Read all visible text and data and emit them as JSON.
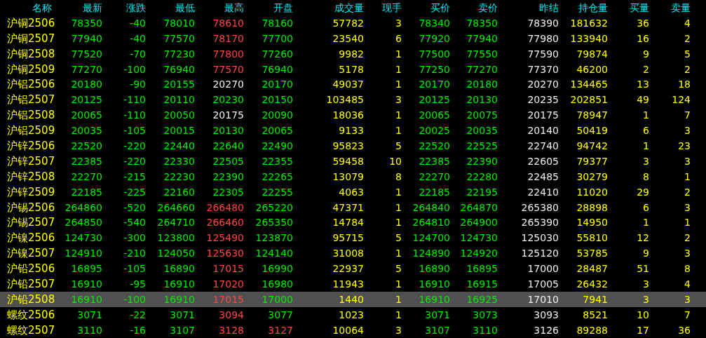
{
  "table": {
    "columns": [
      "名称",
      "最新",
      "涨跌",
      "最低",
      "最高",
      "开盘",
      "成交量",
      "现手",
      "买价",
      "卖价",
      "昨结",
      "持仓量",
      "买量",
      "卖量"
    ],
    "rows": [
      {
        "selected": false,
        "cells": [
          {
            "text": "沪铜2506",
            "color": "#ffff00"
          },
          {
            "text": "78350",
            "color": "#00ee00"
          },
          {
            "text": "-40",
            "color": "#00ee00"
          },
          {
            "text": "78010",
            "color": "#00ee00"
          },
          {
            "text": "78610",
            "color": "#ff4444"
          },
          {
            "text": "78160",
            "color": "#00ee00"
          },
          {
            "text": "57782",
            "color": "#ffff00"
          },
          {
            "text": "3",
            "color": "#ffff00"
          },
          {
            "text": "78340",
            "color": "#00ee00"
          },
          {
            "text": "78350",
            "color": "#00ee00"
          },
          {
            "text": "78390",
            "color": "#eeeeee"
          },
          {
            "text": "181632",
            "color": "#ffff00"
          },
          {
            "text": "36",
            "color": "#ffff00"
          },
          {
            "text": "4",
            "color": "#ffff00"
          }
        ]
      },
      {
        "selected": false,
        "cells": [
          {
            "text": "沪铜2507",
            "color": "#ffff00"
          },
          {
            "text": "77940",
            "color": "#00ee00"
          },
          {
            "text": "-40",
            "color": "#00ee00"
          },
          {
            "text": "77570",
            "color": "#00ee00"
          },
          {
            "text": "78170",
            "color": "#ff4444"
          },
          {
            "text": "77700",
            "color": "#00ee00"
          },
          {
            "text": "23540",
            "color": "#ffff00"
          },
          {
            "text": "6",
            "color": "#ffff00"
          },
          {
            "text": "77920",
            "color": "#00ee00"
          },
          {
            "text": "77940",
            "color": "#00ee00"
          },
          {
            "text": "77980",
            "color": "#eeeeee"
          },
          {
            "text": "133940",
            "color": "#ffff00"
          },
          {
            "text": "16",
            "color": "#ffff00"
          },
          {
            "text": "2",
            "color": "#ffff00"
          }
        ]
      },
      {
        "selected": false,
        "cells": [
          {
            "text": "沪铜2508",
            "color": "#ffff00"
          },
          {
            "text": "77520",
            "color": "#00ee00"
          },
          {
            "text": "-70",
            "color": "#00ee00"
          },
          {
            "text": "77230",
            "color": "#00ee00"
          },
          {
            "text": "77800",
            "color": "#ff4444"
          },
          {
            "text": "77260",
            "color": "#00ee00"
          },
          {
            "text": "9982",
            "color": "#ffff00"
          },
          {
            "text": "1",
            "color": "#ffff00"
          },
          {
            "text": "77500",
            "color": "#00ee00"
          },
          {
            "text": "77550",
            "color": "#00ee00"
          },
          {
            "text": "77590",
            "color": "#eeeeee"
          },
          {
            "text": "79874",
            "color": "#ffff00"
          },
          {
            "text": "9",
            "color": "#ffff00"
          },
          {
            "text": "5",
            "color": "#ffff00"
          }
        ]
      },
      {
        "selected": false,
        "cells": [
          {
            "text": "沪铜2509",
            "color": "#ffff00"
          },
          {
            "text": "77270",
            "color": "#00ee00"
          },
          {
            "text": "-100",
            "color": "#00ee00"
          },
          {
            "text": "76940",
            "color": "#00ee00"
          },
          {
            "text": "77570",
            "color": "#ff4444"
          },
          {
            "text": "76940",
            "color": "#00ee00"
          },
          {
            "text": "5178",
            "color": "#ffff00"
          },
          {
            "text": "1",
            "color": "#ffff00"
          },
          {
            "text": "77250",
            "color": "#00ee00"
          },
          {
            "text": "77270",
            "color": "#00ee00"
          },
          {
            "text": "77370",
            "color": "#eeeeee"
          },
          {
            "text": "46200",
            "color": "#ffff00"
          },
          {
            "text": "2",
            "color": "#ffff00"
          },
          {
            "text": "2",
            "color": "#ffff00"
          }
        ]
      },
      {
        "selected": false,
        "cells": [
          {
            "text": "沪铝2506",
            "color": "#ffff00"
          },
          {
            "text": "20180",
            "color": "#00ee00"
          },
          {
            "text": "-90",
            "color": "#00ee00"
          },
          {
            "text": "20155",
            "color": "#00ee00"
          },
          {
            "text": "20270",
            "color": "#eeeeee"
          },
          {
            "text": "20170",
            "color": "#00ee00"
          },
          {
            "text": "49037",
            "color": "#ffff00"
          },
          {
            "text": "1",
            "color": "#ffff00"
          },
          {
            "text": "20170",
            "color": "#00ee00"
          },
          {
            "text": "20180",
            "color": "#00ee00"
          },
          {
            "text": "20270",
            "color": "#eeeeee"
          },
          {
            "text": "134465",
            "color": "#ffff00"
          },
          {
            "text": "13",
            "color": "#ffff00"
          },
          {
            "text": "18",
            "color": "#ffff00"
          }
        ]
      },
      {
        "selected": false,
        "cells": [
          {
            "text": "沪铝2507",
            "color": "#ffff00"
          },
          {
            "text": "20125",
            "color": "#00ee00"
          },
          {
            "text": "-110",
            "color": "#00ee00"
          },
          {
            "text": "20110",
            "color": "#00ee00"
          },
          {
            "text": "20230",
            "color": "#00ee00"
          },
          {
            "text": "20150",
            "color": "#00ee00"
          },
          {
            "text": "103485",
            "color": "#ffff00"
          },
          {
            "text": "3",
            "color": "#ffff00"
          },
          {
            "text": "20125",
            "color": "#00ee00"
          },
          {
            "text": "20130",
            "color": "#00ee00"
          },
          {
            "text": "20235",
            "color": "#eeeeee"
          },
          {
            "text": "202851",
            "color": "#ffff00"
          },
          {
            "text": "49",
            "color": "#ffff00"
          },
          {
            "text": "124",
            "color": "#ffff00"
          }
        ]
      },
      {
        "selected": false,
        "cells": [
          {
            "text": "沪铝2508",
            "color": "#ffff00"
          },
          {
            "text": "20065",
            "color": "#00ee00"
          },
          {
            "text": "-110",
            "color": "#00ee00"
          },
          {
            "text": "20050",
            "color": "#00ee00"
          },
          {
            "text": "20175",
            "color": "#eeeeee"
          },
          {
            "text": "20090",
            "color": "#00ee00"
          },
          {
            "text": "18036",
            "color": "#ffff00"
          },
          {
            "text": "1",
            "color": "#ffff00"
          },
          {
            "text": "20065",
            "color": "#00ee00"
          },
          {
            "text": "20075",
            "color": "#00ee00"
          },
          {
            "text": "20175",
            "color": "#eeeeee"
          },
          {
            "text": "78947",
            "color": "#ffff00"
          },
          {
            "text": "1",
            "color": "#ffff00"
          },
          {
            "text": "7",
            "color": "#ffff00"
          }
        ]
      },
      {
        "selected": false,
        "cells": [
          {
            "text": "沪铝2509",
            "color": "#ffff00"
          },
          {
            "text": "20035",
            "color": "#00ee00"
          },
          {
            "text": "-105",
            "color": "#00ee00"
          },
          {
            "text": "20015",
            "color": "#00ee00"
          },
          {
            "text": "20130",
            "color": "#00ee00"
          },
          {
            "text": "20065",
            "color": "#00ee00"
          },
          {
            "text": "9133",
            "color": "#ffff00"
          },
          {
            "text": "1",
            "color": "#ffff00"
          },
          {
            "text": "20025",
            "color": "#00ee00"
          },
          {
            "text": "20035",
            "color": "#00ee00"
          },
          {
            "text": "20140",
            "color": "#eeeeee"
          },
          {
            "text": "50419",
            "color": "#ffff00"
          },
          {
            "text": "6",
            "color": "#ffff00"
          },
          {
            "text": "3",
            "color": "#ffff00"
          }
        ]
      },
      {
        "selected": false,
        "cells": [
          {
            "text": "沪锌2506",
            "color": "#ffff00"
          },
          {
            "text": "22520",
            "color": "#00ee00"
          },
          {
            "text": "-220",
            "color": "#00ee00"
          },
          {
            "text": "22440",
            "color": "#00ee00"
          },
          {
            "text": "22640",
            "color": "#00ee00"
          },
          {
            "text": "22490",
            "color": "#00ee00"
          },
          {
            "text": "95823",
            "color": "#ffff00"
          },
          {
            "text": "5",
            "color": "#ffff00"
          },
          {
            "text": "22520",
            "color": "#00ee00"
          },
          {
            "text": "22525",
            "color": "#00ee00"
          },
          {
            "text": "22740",
            "color": "#eeeeee"
          },
          {
            "text": "94742",
            "color": "#ffff00"
          },
          {
            "text": "1",
            "color": "#ffff00"
          },
          {
            "text": "23",
            "color": "#ffff00"
          }
        ]
      },
      {
        "selected": false,
        "cells": [
          {
            "text": "沪锌2507",
            "color": "#ffff00"
          },
          {
            "text": "22385",
            "color": "#00ee00"
          },
          {
            "text": "-220",
            "color": "#00ee00"
          },
          {
            "text": "22330",
            "color": "#00ee00"
          },
          {
            "text": "22505",
            "color": "#00ee00"
          },
          {
            "text": "22355",
            "color": "#00ee00"
          },
          {
            "text": "59458",
            "color": "#ffff00"
          },
          {
            "text": "10",
            "color": "#ffff00"
          },
          {
            "text": "22385",
            "color": "#00ee00"
          },
          {
            "text": "22390",
            "color": "#00ee00"
          },
          {
            "text": "22605",
            "color": "#eeeeee"
          },
          {
            "text": "79377",
            "color": "#ffff00"
          },
          {
            "text": "3",
            "color": "#ffff00"
          },
          {
            "text": "3",
            "color": "#ffff00"
          }
        ]
      },
      {
        "selected": false,
        "cells": [
          {
            "text": "沪锌2508",
            "color": "#ffff00"
          },
          {
            "text": "22270",
            "color": "#00ee00"
          },
          {
            "text": "-215",
            "color": "#00ee00"
          },
          {
            "text": "22230",
            "color": "#00ee00"
          },
          {
            "text": "22390",
            "color": "#00ee00"
          },
          {
            "text": "22265",
            "color": "#00ee00"
          },
          {
            "text": "13079",
            "color": "#ffff00"
          },
          {
            "text": "8",
            "color": "#ffff00"
          },
          {
            "text": "22270",
            "color": "#00ee00"
          },
          {
            "text": "22280",
            "color": "#00ee00"
          },
          {
            "text": "22485",
            "color": "#eeeeee"
          },
          {
            "text": "30279",
            "color": "#ffff00"
          },
          {
            "text": "8",
            "color": "#ffff00"
          },
          {
            "text": "1",
            "color": "#ffff00"
          }
        ]
      },
      {
        "selected": false,
        "cells": [
          {
            "text": "沪锌2509",
            "color": "#ffff00"
          },
          {
            "text": "22185",
            "color": "#00ee00"
          },
          {
            "text": "-225",
            "color": "#00ee00"
          },
          {
            "text": "22160",
            "color": "#00ee00"
          },
          {
            "text": "22305",
            "color": "#00ee00"
          },
          {
            "text": "22255",
            "color": "#00ee00"
          },
          {
            "text": "4063",
            "color": "#ffff00"
          },
          {
            "text": "1",
            "color": "#ffff00"
          },
          {
            "text": "22185",
            "color": "#00ee00"
          },
          {
            "text": "22195",
            "color": "#00ee00"
          },
          {
            "text": "22410",
            "color": "#eeeeee"
          },
          {
            "text": "11020",
            "color": "#ffff00"
          },
          {
            "text": "29",
            "color": "#ffff00"
          },
          {
            "text": "2",
            "color": "#ffff00"
          }
        ]
      },
      {
        "selected": false,
        "cells": [
          {
            "text": "沪锡2506",
            "color": "#ffff00"
          },
          {
            "text": "264860",
            "color": "#00ee00"
          },
          {
            "text": "-520",
            "color": "#00ee00"
          },
          {
            "text": "264660",
            "color": "#00ee00"
          },
          {
            "text": "266480",
            "color": "#ff4444"
          },
          {
            "text": "265220",
            "color": "#00ee00"
          },
          {
            "text": "47371",
            "color": "#ffff00"
          },
          {
            "text": "1",
            "color": "#ffff00"
          },
          {
            "text": "264840",
            "color": "#00ee00"
          },
          {
            "text": "264870",
            "color": "#00ee00"
          },
          {
            "text": "265380",
            "color": "#eeeeee"
          },
          {
            "text": "28898",
            "color": "#ffff00"
          },
          {
            "text": "6",
            "color": "#ffff00"
          },
          {
            "text": "3",
            "color": "#ffff00"
          }
        ]
      },
      {
        "selected": false,
        "cells": [
          {
            "text": "沪锡2507",
            "color": "#ffff00"
          },
          {
            "text": "264850",
            "color": "#00ee00"
          },
          {
            "text": "-540",
            "color": "#00ee00"
          },
          {
            "text": "264710",
            "color": "#00ee00"
          },
          {
            "text": "266460",
            "color": "#ff4444"
          },
          {
            "text": "265350",
            "color": "#00ee00"
          },
          {
            "text": "14784",
            "color": "#ffff00"
          },
          {
            "text": "1",
            "color": "#ffff00"
          },
          {
            "text": "264810",
            "color": "#00ee00"
          },
          {
            "text": "264900",
            "color": "#00ee00"
          },
          {
            "text": "265390",
            "color": "#eeeeee"
          },
          {
            "text": "14950",
            "color": "#ffff00"
          },
          {
            "text": "1",
            "color": "#ffff00"
          },
          {
            "text": "1",
            "color": "#ffff00"
          }
        ]
      },
      {
        "selected": false,
        "cells": [
          {
            "text": "沪镍2506",
            "color": "#ffff00"
          },
          {
            "text": "124730",
            "color": "#00ee00"
          },
          {
            "text": "-300",
            "color": "#00ee00"
          },
          {
            "text": "123800",
            "color": "#00ee00"
          },
          {
            "text": "125490",
            "color": "#ff4444"
          },
          {
            "text": "123870",
            "color": "#00ee00"
          },
          {
            "text": "95715",
            "color": "#ffff00"
          },
          {
            "text": "5",
            "color": "#ffff00"
          },
          {
            "text": "124700",
            "color": "#00ee00"
          },
          {
            "text": "124730",
            "color": "#00ee00"
          },
          {
            "text": "125030",
            "color": "#eeeeee"
          },
          {
            "text": "55810",
            "color": "#ffff00"
          },
          {
            "text": "12",
            "color": "#ffff00"
          },
          {
            "text": "2",
            "color": "#ffff00"
          }
        ]
      },
      {
        "selected": false,
        "cells": [
          {
            "text": "沪镍2507",
            "color": "#ffff00"
          },
          {
            "text": "124910",
            "color": "#00ee00"
          },
          {
            "text": "-210",
            "color": "#00ee00"
          },
          {
            "text": "124050",
            "color": "#00ee00"
          },
          {
            "text": "125630",
            "color": "#ff4444"
          },
          {
            "text": "124140",
            "color": "#00ee00"
          },
          {
            "text": "31008",
            "color": "#ffff00"
          },
          {
            "text": "1",
            "color": "#ffff00"
          },
          {
            "text": "124890",
            "color": "#00ee00"
          },
          {
            "text": "124920",
            "color": "#00ee00"
          },
          {
            "text": "125120",
            "color": "#eeeeee"
          },
          {
            "text": "53785",
            "color": "#ffff00"
          },
          {
            "text": "9",
            "color": "#ffff00"
          },
          {
            "text": "3",
            "color": "#ffff00"
          }
        ]
      },
      {
        "selected": false,
        "cells": [
          {
            "text": "沪铅2506",
            "color": "#ffff00"
          },
          {
            "text": "16895",
            "color": "#00ee00"
          },
          {
            "text": "-105",
            "color": "#00ee00"
          },
          {
            "text": "16890",
            "color": "#00ee00"
          },
          {
            "text": "17015",
            "color": "#ff4444"
          },
          {
            "text": "16990",
            "color": "#00ee00"
          },
          {
            "text": "22937",
            "color": "#ffff00"
          },
          {
            "text": "5",
            "color": "#ffff00"
          },
          {
            "text": "16890",
            "color": "#00ee00"
          },
          {
            "text": "16895",
            "color": "#00ee00"
          },
          {
            "text": "17000",
            "color": "#eeeeee"
          },
          {
            "text": "28487",
            "color": "#ffff00"
          },
          {
            "text": "51",
            "color": "#ffff00"
          },
          {
            "text": "8",
            "color": "#ffff00"
          }
        ]
      },
      {
        "selected": false,
        "cells": [
          {
            "text": "沪铅2507",
            "color": "#ffff00"
          },
          {
            "text": "16910",
            "color": "#00ee00"
          },
          {
            "text": "-95",
            "color": "#00ee00"
          },
          {
            "text": "16910",
            "color": "#00ee00"
          },
          {
            "text": "17020",
            "color": "#ff4444"
          },
          {
            "text": "16980",
            "color": "#00ee00"
          },
          {
            "text": "11943",
            "color": "#ffff00"
          },
          {
            "text": "1",
            "color": "#ffff00"
          },
          {
            "text": "16910",
            "color": "#00ee00"
          },
          {
            "text": "16915",
            "color": "#00ee00"
          },
          {
            "text": "17005",
            "color": "#eeeeee"
          },
          {
            "text": "26432",
            "color": "#ffff00"
          },
          {
            "text": "3",
            "color": "#ffff00"
          },
          {
            "text": "4",
            "color": "#ffff00"
          }
        ]
      },
      {
        "selected": true,
        "cells": [
          {
            "text": "沪铅2508",
            "color": "#ffff00"
          },
          {
            "text": "16910",
            "color": "#00ee00"
          },
          {
            "text": "-100",
            "color": "#00ee00"
          },
          {
            "text": "16910",
            "color": "#00ee00"
          },
          {
            "text": "17015",
            "color": "#ff4444"
          },
          {
            "text": "17000",
            "color": "#00ee00"
          },
          {
            "text": "1440",
            "color": "#ffff00"
          },
          {
            "text": "1",
            "color": "#ffff00"
          },
          {
            "text": "16910",
            "color": "#00ee00"
          },
          {
            "text": "16925",
            "color": "#00ee00"
          },
          {
            "text": "17010",
            "color": "#eeeeee"
          },
          {
            "text": "7941",
            "color": "#ffff00"
          },
          {
            "text": "3",
            "color": "#ffff00"
          },
          {
            "text": "3",
            "color": "#ffff00"
          }
        ]
      },
      {
        "selected": false,
        "cells": [
          {
            "text": "螺纹2506",
            "color": "#ffff00"
          },
          {
            "text": "3071",
            "color": "#00ee00"
          },
          {
            "text": "-22",
            "color": "#00ee00"
          },
          {
            "text": "3071",
            "color": "#00ee00"
          },
          {
            "text": "3094",
            "color": "#ff4444"
          },
          {
            "text": "3077",
            "color": "#00ee00"
          },
          {
            "text": "1023",
            "color": "#ffff00"
          },
          {
            "text": "1",
            "color": "#ffff00"
          },
          {
            "text": "3071",
            "color": "#00ee00"
          },
          {
            "text": "3073",
            "color": "#00ee00"
          },
          {
            "text": "3093",
            "color": "#eeeeee"
          },
          {
            "text": "8521",
            "color": "#ffff00"
          },
          {
            "text": "10",
            "color": "#ffff00"
          },
          {
            "text": "7",
            "color": "#ffff00"
          }
        ]
      },
      {
        "selected": false,
        "cells": [
          {
            "text": "螺纹2507",
            "color": "#ffff00"
          },
          {
            "text": "3110",
            "color": "#00ee00"
          },
          {
            "text": "-16",
            "color": "#00ee00"
          },
          {
            "text": "3107",
            "color": "#00ee00"
          },
          {
            "text": "3128",
            "color": "#ff4444"
          },
          {
            "text": "3127",
            "color": "#ff4444"
          },
          {
            "text": "10064",
            "color": "#ffff00"
          },
          {
            "text": "3",
            "color": "#ffff00"
          },
          {
            "text": "3107",
            "color": "#00ee00"
          },
          {
            "text": "3110",
            "color": "#00ee00"
          },
          {
            "text": "3126",
            "color": "#eeeeee"
          },
          {
            "text": "89288",
            "color": "#ffff00"
          },
          {
            "text": "17",
            "color": "#ffff00"
          },
          {
            "text": "36",
            "color": "#ffff00"
          }
        ]
      }
    ]
  }
}
